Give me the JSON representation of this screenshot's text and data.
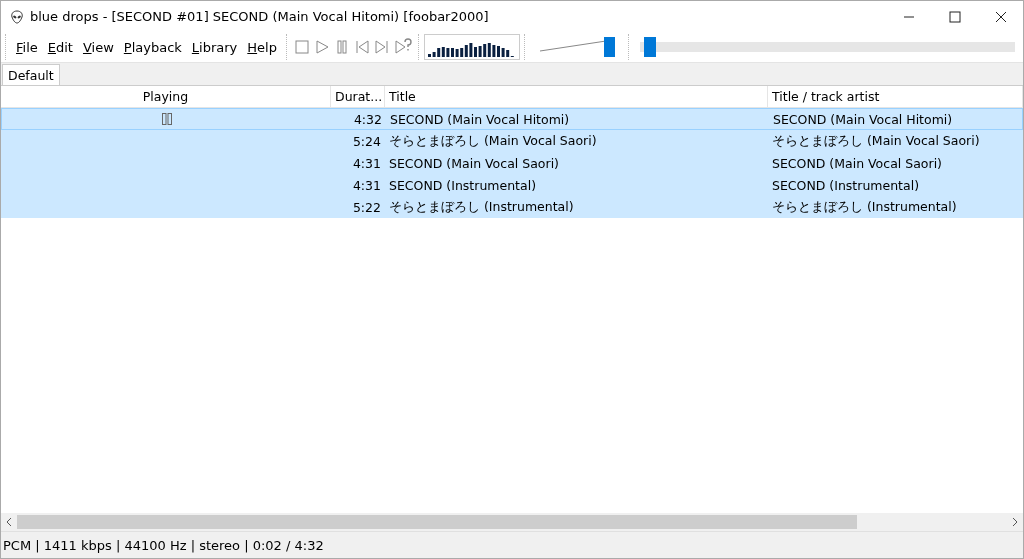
{
  "window": {
    "title": "blue drops - [SECOND #01] SECOND (Main Vocal Hitomi)  [foobar2000]"
  },
  "menu": [
    "File",
    "Edit",
    "View",
    "Playback",
    "Library",
    "Help"
  ],
  "volume": {
    "level": 1.0
  },
  "seek": {
    "level": 0.01
  },
  "tabs": [
    {
      "label": "Default",
      "selected": true
    }
  ],
  "table": {
    "columns": [
      "Playing",
      "Durat...",
      "Title",
      "Title / track artist"
    ],
    "rows": [
      {
        "playing": true,
        "selected": true,
        "duration": "4:32",
        "title": "SECOND (Main Vocal Hitomi)",
        "artist": "SECOND (Main Vocal Hitomi)"
      },
      {
        "playing": false,
        "selected": true,
        "duration": "5:24",
        "title": "そらとまぼろし (Main Vocal Saori)",
        "artist": "そらとまぼろし (Main Vocal Saori)"
      },
      {
        "playing": false,
        "selected": true,
        "duration": "4:31",
        "title": "SECOND (Main Vocal Saori)",
        "artist": "SECOND (Main Vocal Saori)"
      },
      {
        "playing": false,
        "selected": true,
        "duration": "4:31",
        "title": "SECOND (Instrumental)",
        "artist": "SECOND (Instrumental)"
      },
      {
        "playing": false,
        "selected": true,
        "duration": "5:22",
        "title": "そらとまぼろし (Instrumental)",
        "artist": "そらとまぼろし (Instrumental)"
      }
    ]
  },
  "status_bar": "PCM | 1411 kbps | 44100 Hz | stereo | 0:02 / 4:32"
}
